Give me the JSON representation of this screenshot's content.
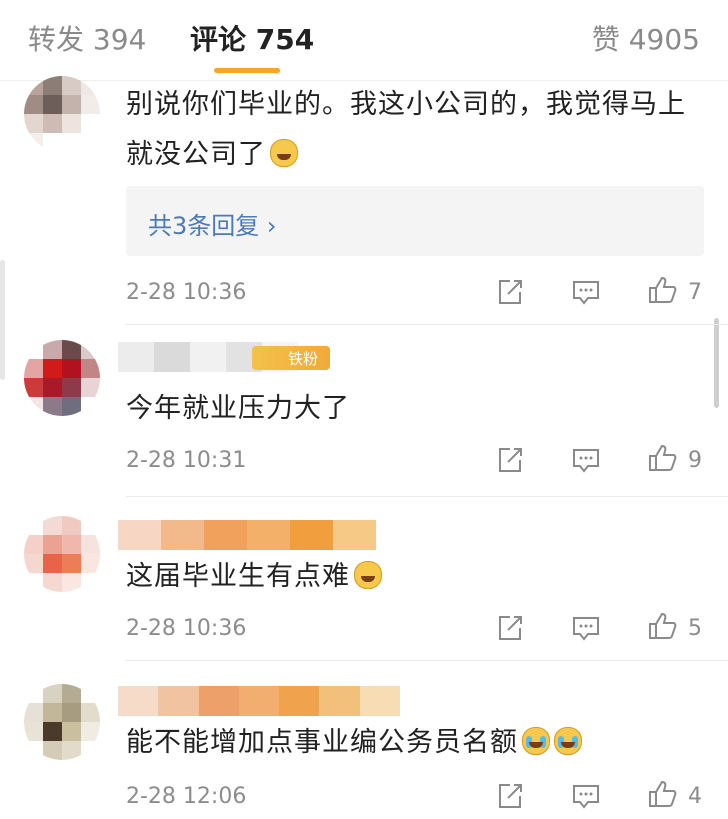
{
  "tabs": {
    "reposts": "转发 394",
    "comments": "评论 754",
    "likes": "赞 4905"
  },
  "comments": [
    {
      "text": "别说你们毕业的。我这小公司的，我觉得马上就没公司了",
      "emoji": "laugh-cry-emoji",
      "replies_label": "共3条回复 ›",
      "time": "2-28 10:36",
      "likes": "7"
    },
    {
      "badge_text": "铁粉",
      "text": "今年就业压力大了",
      "time": "2-28 10:31",
      "likes": "9"
    },
    {
      "text": "这届毕业生有点难",
      "emoji": "laugh-cry-emoji",
      "time": "2-28 10:36",
      "likes": "5"
    },
    {
      "text": "能不能增加点事业编公务员名额",
      "emoji": "crying-emoji",
      "time": "2-28 12:06",
      "likes": "4"
    }
  ],
  "colors": {
    "accent": "#f5a623",
    "link": "#4a7ab8",
    "muted": "#8c8c8c"
  }
}
